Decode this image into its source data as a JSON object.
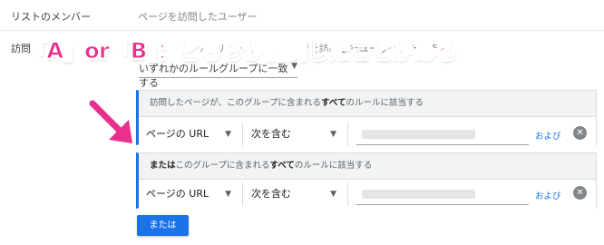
{
  "list_members": {
    "label": "リストのメンバー",
    "value": "ページを訪問したユーザー"
  },
  "visited": {
    "label": "訪問",
    "hint": "ルールに一致したページを訪問したユーザーを含めます",
    "group_select": "いずれかのルールグループに一致する"
  },
  "annotation": {
    "text": "「A」or「B」：どちらか訪問したことがある",
    "color": "#e8308c"
  },
  "groups": [
    {
      "header_pre": "訪問したページが、このグループに含まれる",
      "header_bold": "すべて",
      "header_post": "のルールに該当する",
      "field": "ページの URL",
      "operator": "次を含む",
      "and_label": "および"
    },
    {
      "header_pre": "または",
      "header_mid": "このグループに含まれる",
      "header_bold": "すべて",
      "header_post": "のルールに該当する",
      "field": "ページの URL",
      "operator": "次を含む",
      "and_label": "および"
    }
  ],
  "or_button": "または",
  "accent_color": "#1a73e8"
}
